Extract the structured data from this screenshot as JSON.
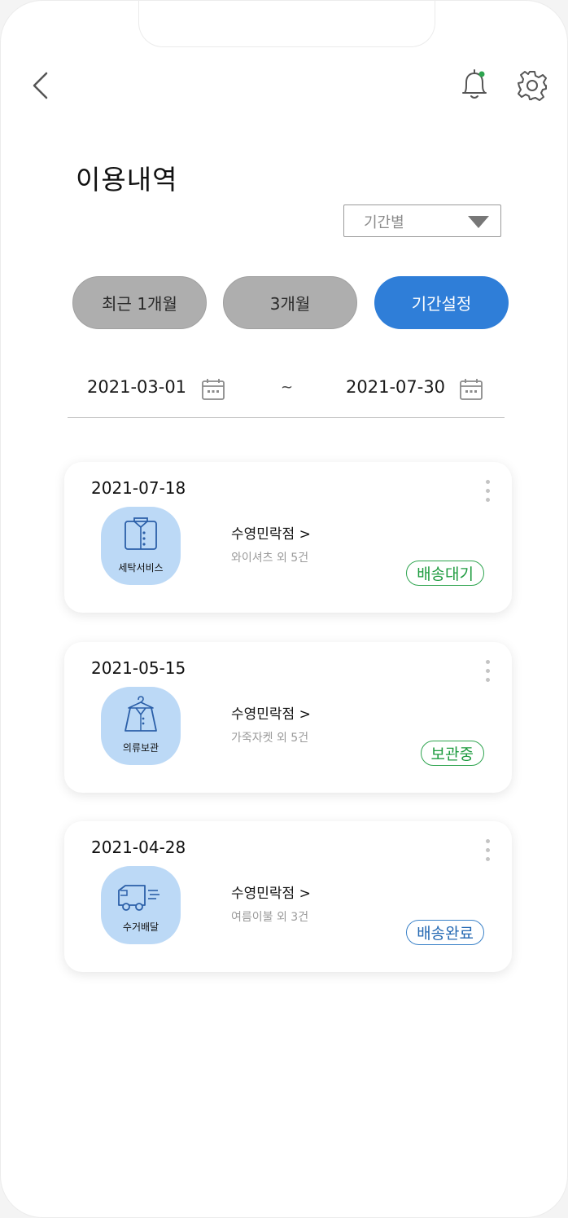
{
  "header": {
    "back_icon": "chevron-left-icon",
    "bell_icon": "bell-icon",
    "settings_icon": "gear-icon",
    "notification_dot_color": "#2ea44f"
  },
  "page_title": "이용내역",
  "period_select": {
    "selected": "기간별"
  },
  "period_tabs": [
    {
      "label": "최근 1개월",
      "active": false
    },
    {
      "label": "3개월",
      "active": false
    },
    {
      "label": "기간설정",
      "active": true
    }
  ],
  "date_range": {
    "start": "2021-03-01",
    "separator": "~",
    "end": "2021-07-30"
  },
  "accent_color": "#2f7ed8",
  "history": [
    {
      "date": "2021-07-18",
      "service": "세탁서비스",
      "icon": "shirt-icon",
      "store": "수영민락점 >",
      "items": "와이셔츠 외 5건",
      "status": "배송대기",
      "status_color": "#1e9b3f"
    },
    {
      "date": "2021-05-15",
      "service": "의류보관",
      "icon": "hanger-jacket-icon",
      "store": "수영민락점 >",
      "items": "가죽자켓 외 5건",
      "status": "보관중",
      "status_color": "#1e9b3f"
    },
    {
      "date": "2021-04-28",
      "service": "수거배달",
      "icon": "delivery-truck-icon",
      "store": "수영민락점 >",
      "items": "여름이불 외 3건",
      "status": "배송완료",
      "status_color": "#2569b3"
    }
  ]
}
